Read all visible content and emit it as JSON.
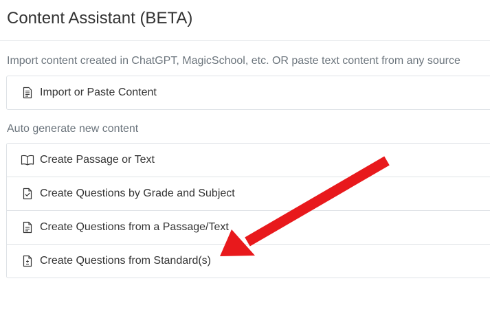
{
  "header": {
    "title": "Content Assistant (BETA)"
  },
  "import_section": {
    "description": "Import content created in ChatGPT, MagicSchool, etc. OR paste text content from any source",
    "items": [
      {
        "label": "Import or Paste Content",
        "icon": "document-lines-icon"
      }
    ]
  },
  "auto_section": {
    "description": "Auto generate new content",
    "items": [
      {
        "label": "Create Passage or Text",
        "icon": "open-book-icon"
      },
      {
        "label": "Create Questions by Grade and Subject",
        "icon": "document-check-icon"
      },
      {
        "label": "Create Questions from a Passage/Text",
        "icon": "document-text-icon"
      },
      {
        "label": "Create Questions from Standard(s)",
        "icon": "document-plus-minus-icon"
      }
    ]
  },
  "colors": {
    "annotation_arrow": "#e8191c",
    "border": "#dee2e6",
    "muted_text": "#6c757d",
    "text": "#333333"
  }
}
